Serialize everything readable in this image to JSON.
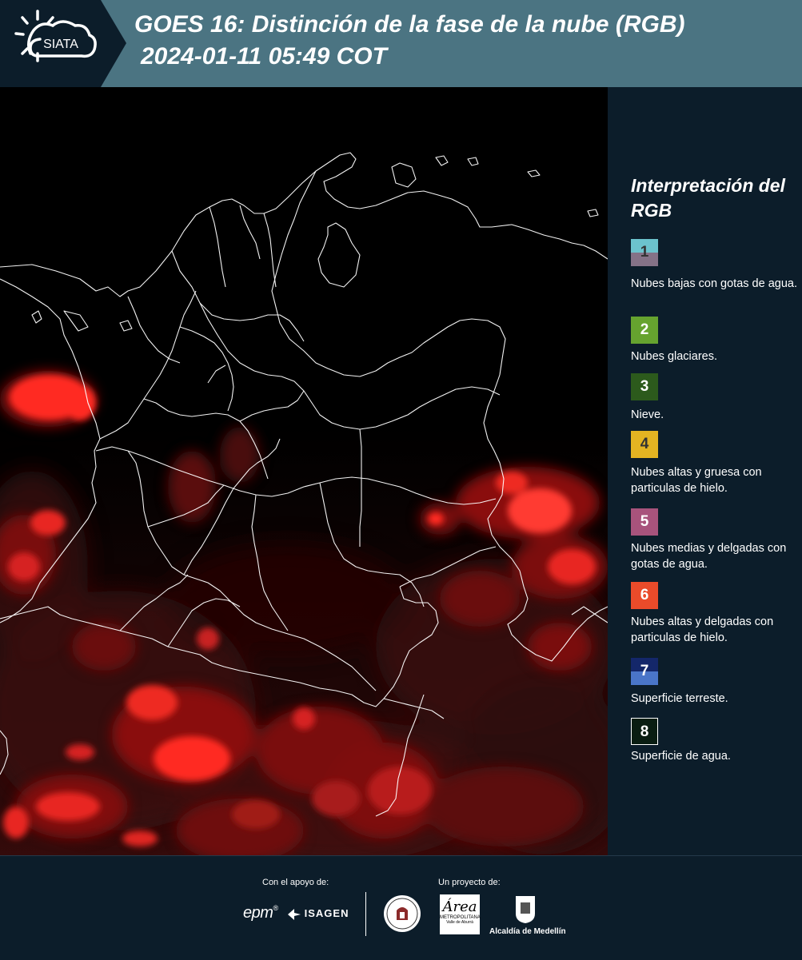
{
  "header": {
    "title_line1": "GOES 16: Distinción de la fase de la nube (RGB)",
    "title_line2": "2024-01-11 05:49 COT",
    "logo_text": "SIATA"
  },
  "legend": {
    "title": "Interpretación del RGB",
    "items": [
      {
        "number": "1",
        "label": "Nubes bajas con gotas de agua.",
        "colors": [
          "#6cc3cd",
          "#857287"
        ]
      },
      {
        "number": "2",
        "label": "Nubes glaciares.",
        "colors": [
          "#66a32f"
        ]
      },
      {
        "number": "3",
        "label": "Nieve.",
        "colors": [
          "#2c5a1c"
        ]
      },
      {
        "number": "4",
        "label": "Nubes altas y gruesa con particulas de hielo.",
        "colors": [
          "#e4b422"
        ]
      },
      {
        "number": "5",
        "label": "Nubes medias y delgadas con gotas de agua.",
        "colors": [
          "#a8537c"
        ]
      },
      {
        "number": "6",
        "label": "Nubes altas y delgadas con particulas de hielo.",
        "colors": [
          "#ea4b2a"
        ]
      },
      {
        "number": "7",
        "label": "Superficie terreste.",
        "colors": [
          "#14276a",
          "#4a75c8"
        ]
      },
      {
        "number": "8",
        "label": "Superficie de agua.",
        "colors": [
          "#0a1d12"
        ]
      }
    ]
  },
  "footer": {
    "support_label": "Con el apoyo de:",
    "project_label": "Un proyecto de:",
    "sponsor1": "epm",
    "sponsor2": "ISAGEN",
    "partner1": "METROPOLITANA",
    "partner1_sub": "Valle de Aburrá",
    "partner2": "Alcaldía de Medellín"
  }
}
